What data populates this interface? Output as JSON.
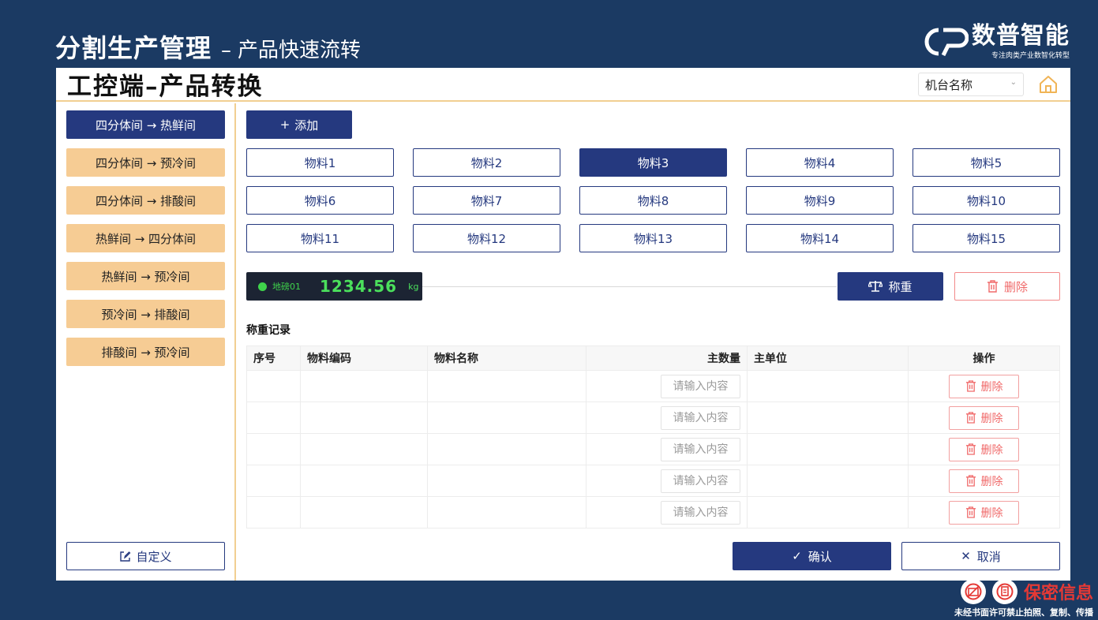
{
  "slide": {
    "title": "分割生产管理",
    "separator": "–",
    "subtitle": "产品快速流转",
    "brand_name": "数普智能",
    "brand_slogan": "专注肉类产业数智化转型"
  },
  "app": {
    "title": "工控端–产品转换",
    "machine_select": {
      "value": "机台名称"
    },
    "icons": {
      "home": "home-icon",
      "chevron": "chevron-down-icon"
    }
  },
  "sidebar": {
    "items": [
      {
        "label": "四分体间 → 热鲜间",
        "active": true
      },
      {
        "label": "四分体间 → 预冷间",
        "active": false
      },
      {
        "label": "四分体间 → 排酸间",
        "active": false
      },
      {
        "label": "热鲜间 → 四分体间",
        "active": false
      },
      {
        "label": "热鲜间 → 预冷间",
        "active": false
      },
      {
        "label": "预冷间 → 排酸间",
        "active": false
      },
      {
        "label": "排酸间 → 预冷间",
        "active": false
      }
    ],
    "custom_label": "自定义"
  },
  "toolbar": {
    "add_label": "添加",
    "add_glyph": "+"
  },
  "materials": [
    {
      "label": "物料1",
      "selected": false
    },
    {
      "label": "物料2",
      "selected": false
    },
    {
      "label": "物料3",
      "selected": true
    },
    {
      "label": "物料4",
      "selected": false
    },
    {
      "label": "物料5",
      "selected": false
    },
    {
      "label": "物料6",
      "selected": false
    },
    {
      "label": "物料7",
      "selected": false
    },
    {
      "label": "物料8",
      "selected": false
    },
    {
      "label": "物料9",
      "selected": false
    },
    {
      "label": "物料10",
      "selected": false
    },
    {
      "label": "物料11",
      "selected": false
    },
    {
      "label": "物料12",
      "selected": false
    },
    {
      "label": "物料13",
      "selected": false
    },
    {
      "label": "物料14",
      "selected": false
    },
    {
      "label": "物料15",
      "selected": false
    }
  ],
  "scale": {
    "name": "地磅01",
    "weight": "1234.56",
    "unit": "kg",
    "status_color": "#3fd34b"
  },
  "actions": {
    "weigh_label": "称重",
    "delete_label": "删除"
  },
  "records": {
    "title": "称重记录",
    "columns": [
      "序号",
      "物料编码",
      "物料名称",
      "主数量",
      "主单位",
      "操作"
    ],
    "qty_placeholder": "请输入内容",
    "row_delete_label": "删除",
    "row_count": 5
  },
  "footer": {
    "confirm_label": "确认",
    "cancel_label": "取消"
  },
  "confidential": {
    "label": "保密信息",
    "notice": "未经书面许可禁止拍照、复制、传播"
  },
  "colors": {
    "background": "#1b3a63",
    "primary": "#25397f",
    "route": "#f6cc94",
    "accent_line": "#f1cf92",
    "danger": "#f06a6a"
  }
}
